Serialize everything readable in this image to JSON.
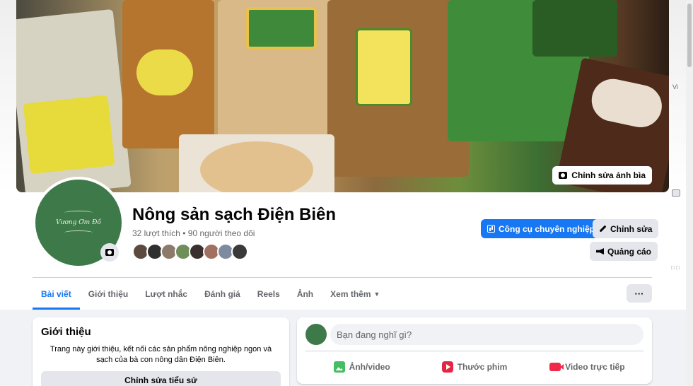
{
  "cover": {
    "edit_label": "Chỉnh sửa ảnh bìa"
  },
  "page": {
    "title": "Nông sản sạch Điện Biên",
    "stats": "32 lượt thích • 90 người theo dõi",
    "follower_colors": [
      "#5d4a3e",
      "#2f2f2f",
      "#8c7b6b",
      "#6f8f5a",
      "#3b3030",
      "#a07060",
      "#7d8aa0",
      "#3a3a3a"
    ]
  },
  "actions": {
    "pro_tools": "Công cụ chuyên nghiệp",
    "edit": "Chỉnh sửa",
    "ads": "Quảng cáo"
  },
  "tabs": [
    {
      "label": "Bài viết",
      "active": true
    },
    {
      "label": "Giới thiệu"
    },
    {
      "label": "Lượt nhắc"
    },
    {
      "label": "Đánh giá"
    },
    {
      "label": "Reels"
    },
    {
      "label": "Ảnh"
    },
    {
      "label": "Xem thêm"
    }
  ],
  "more_button": "···",
  "intro": {
    "title": "Giới thiệu",
    "description": "Trang này giới thiệu, kết nối các sản phẩm nông nghiệp ngon và sạch của bà con nông dân Điện Biên.",
    "edit_bio": "Chỉnh sửa tiểu sử"
  },
  "composer": {
    "placeholder": "Bạn đang nghĩ gì?",
    "photo_video": "Ảnh/video",
    "reel": "Thước phim",
    "live_video": "Video trực tiếp"
  },
  "side": {
    "lang_short": "Vi",
    "mini": "□ □"
  },
  "colors": {
    "accent": "#1877f2",
    "avatar_green": "#3e7a49"
  }
}
